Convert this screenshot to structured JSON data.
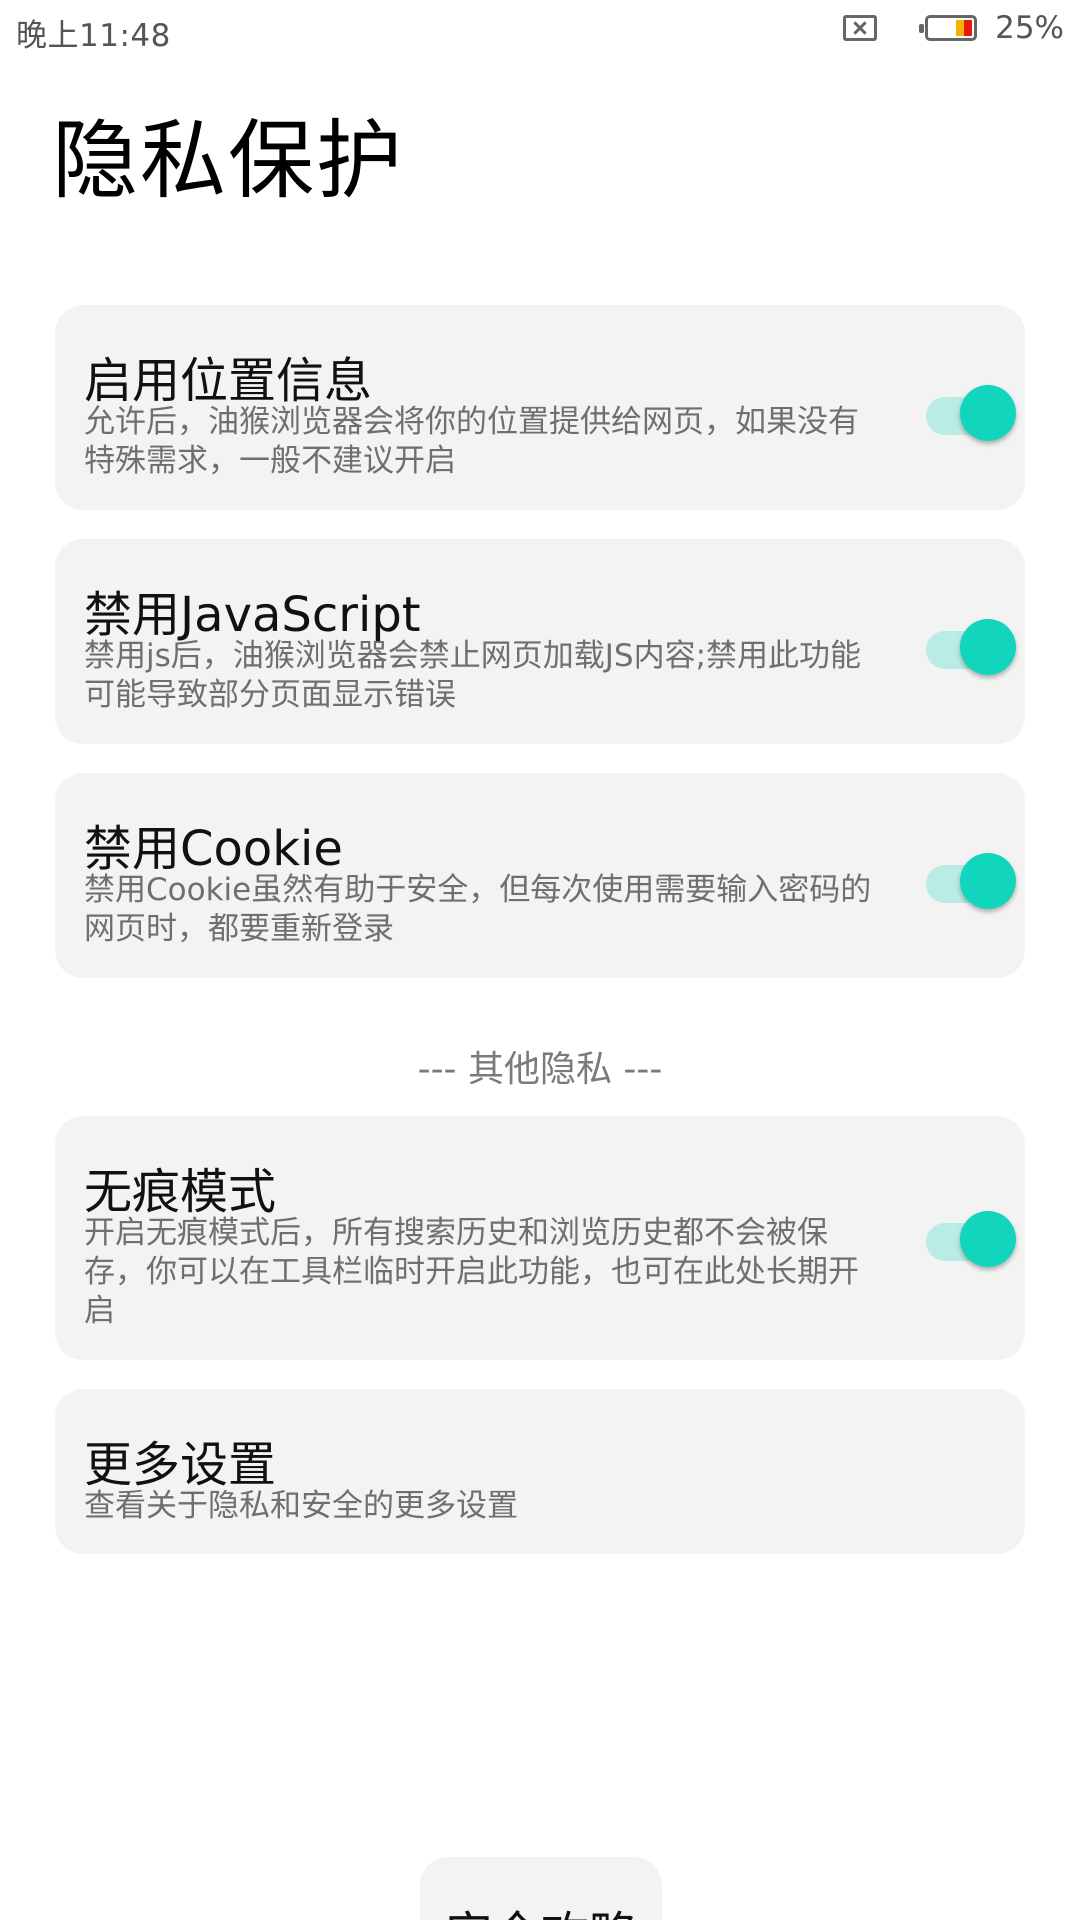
{
  "status_bar": {
    "time": "晚上11:48",
    "sim_icon": "no-sim-icon",
    "battery_icon": "battery-icon",
    "battery_percent": "25%",
    "battery_level": 0.25,
    "colors": {
      "battery_low": "#e8180f",
      "battery_mid": "#f3b300"
    }
  },
  "page": {
    "title": "隐私保护"
  },
  "settings": [
    {
      "title": "启用位置信息",
      "description": "允许后，油猴浏览器会将你的位置提供给网页，如果没有特殊需求，一般不建议开启",
      "enabled": true
    },
    {
      "title": "禁用JavaScript",
      "description": "禁用js后，油猴浏览器会禁止网页加载JS内容;禁用此功能可能导致部分页面显示错误",
      "enabled": true
    },
    {
      "title": "禁用Cookie",
      "description": "禁用Cookie虽然有助于安全，但每次使用需要输入密码的网页时，都要重新登录",
      "enabled": true
    }
  ],
  "section_divider": "--- 其他隐私 ---",
  "other": {
    "incognito": {
      "title": "无痕模式",
      "description": "开启无痕模式后，所有搜索历史和浏览历史都不会被保存，你可以在工具栏临时开启此功能，也可在此处长期开启",
      "enabled": true
    },
    "more": {
      "title": "更多设置",
      "description": "查看关于隐私和安全的更多设置"
    }
  },
  "bottom_button": {
    "label": "安全攻略"
  },
  "colors": {
    "toggle_on": "#11d6bd",
    "toggle_track_on": "#b9ece4",
    "card_bg": "#f3f3f3"
  }
}
